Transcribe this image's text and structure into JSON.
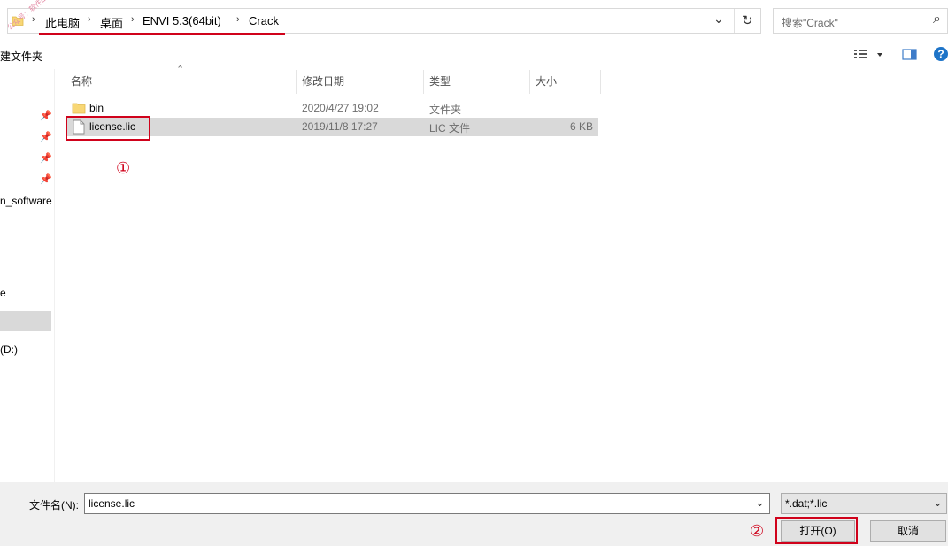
{
  "address": {
    "crumbs": [
      "此电脑",
      "桌面",
      "ENVI 5.3(64bit)",
      "Crack"
    ],
    "separator": "›",
    "dropdown": "⌄",
    "refresh": "↻"
  },
  "search": {
    "placeholder": "搜索\"Crack\"",
    "icon": "⌕"
  },
  "toolbar": {
    "new_folder": "建文件夹",
    "help": "?"
  },
  "watermark": "公众号：软件山持",
  "sidebar": {
    "items": [
      "n_software",
      "e",
      "(D:)"
    ]
  },
  "columns": {
    "name": "名称",
    "modified": "修改日期",
    "type": "类型",
    "size": "大小"
  },
  "files": [
    {
      "name": "bin",
      "modified": "2020/4/27 19:02",
      "type": "文件夹",
      "size": ""
    },
    {
      "name": "license.lic",
      "modified": "2019/11/8 17:27",
      "type": "LIC 文件",
      "size": "6 KB"
    }
  ],
  "annotations": {
    "step1": "①",
    "step2": "②"
  },
  "bottom": {
    "filename_label": "文件名(N):",
    "filename_value": "license.lic",
    "filter_value": "*.dat;*.lic",
    "open_label": "打开(O)",
    "cancel_label": "取消"
  },
  "colors": {
    "accent_red": "#d0021b",
    "folder_yellow": "#f8d775",
    "selected_row": "#d9d9d9"
  }
}
